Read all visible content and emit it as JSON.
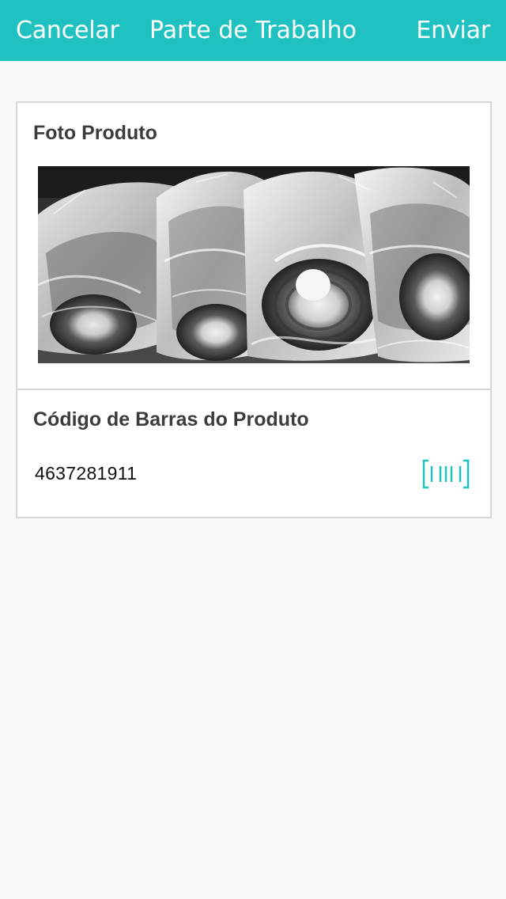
{
  "navbar": {
    "cancel_label": "Cancelar",
    "title": "Parte de Trabalho",
    "send_label": "Enviar",
    "background_color": "#1fc2c0"
  },
  "product_photo": {
    "title": "Foto Produto"
  },
  "barcode": {
    "title": "Código de Barras do Produto",
    "value": "4637281911",
    "scan_icon": "barcode-scan-icon",
    "icon_color": "#1fc2c0"
  }
}
